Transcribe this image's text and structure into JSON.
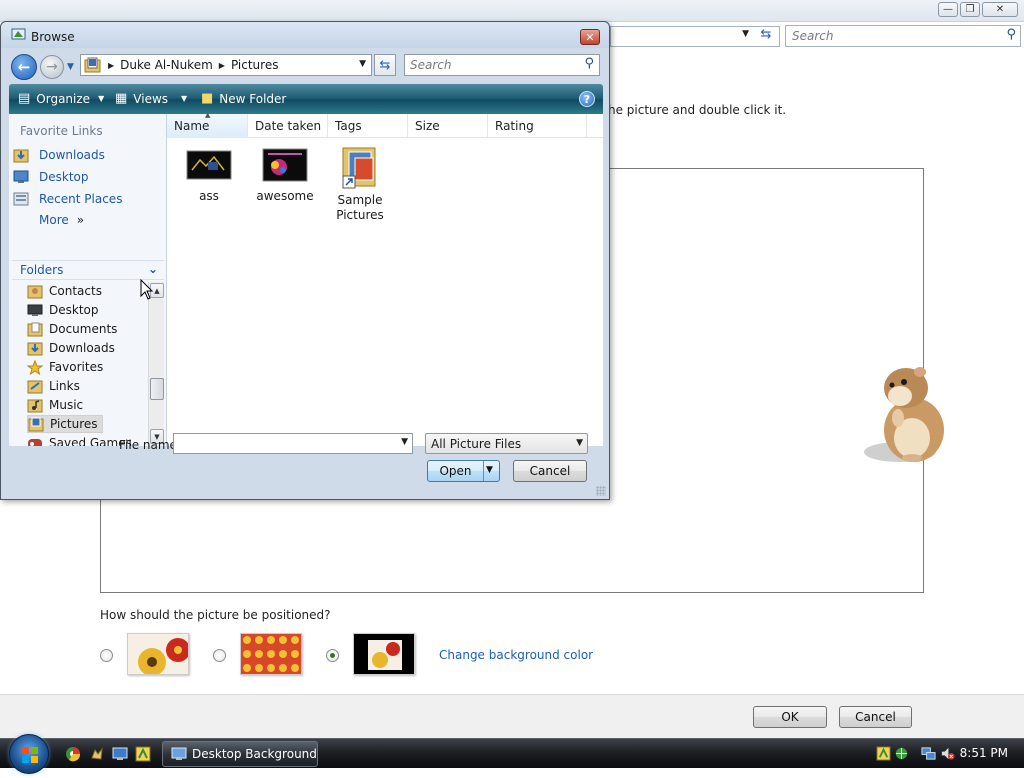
{
  "background_window": {
    "search_placeholder": "Search",
    "instruction_text": "he picture and double click it.",
    "position_question": "How should the picture be positioned?",
    "change_bg_color_link": "Change background color",
    "position_options": [
      {
        "name": "fit-to-screen",
        "selected": false
      },
      {
        "name": "tile",
        "selected": false
      },
      {
        "name": "center",
        "selected": true
      }
    ],
    "ok_label": "OK",
    "cancel_label": "Cancel",
    "window_controls": {
      "minimize": "—",
      "maximize": "❐",
      "close": "✕"
    }
  },
  "dialog": {
    "title": "Browse",
    "close_glyph": "✕",
    "breadcrumb": [
      "Duke Al-Nukem",
      "Pictures"
    ],
    "search_placeholder": "Search",
    "toolbar": {
      "organize": "Organize",
      "views": "Views",
      "new_folder": "New Folder",
      "help": "?"
    },
    "favorite_links": {
      "header": "Favorite Links",
      "items": [
        {
          "label": "Downloads",
          "icon": "downloads-icon"
        },
        {
          "label": "Desktop",
          "icon": "desktop-icon"
        },
        {
          "label": "Recent Places",
          "icon": "recent-places-icon"
        },
        {
          "label": "More",
          "icon": "more-chevron-icon",
          "glyph": "»"
        }
      ]
    },
    "folders_header": "Folders",
    "folder_tree": [
      {
        "label": "Contacts",
        "icon": "contacts-folder-icon",
        "selected": false
      },
      {
        "label": "Desktop",
        "icon": "desktop-icon",
        "selected": false
      },
      {
        "label": "Documents",
        "icon": "documents-folder-icon",
        "selected": false
      },
      {
        "label": "Downloads",
        "icon": "downloads-folder-icon",
        "selected": false
      },
      {
        "label": "Favorites",
        "icon": "favorites-star-icon",
        "selected": false
      },
      {
        "label": "Links",
        "icon": "links-folder-icon",
        "selected": false
      },
      {
        "label": "Music",
        "icon": "music-folder-icon",
        "selected": false
      },
      {
        "label": "Pictures",
        "icon": "pictures-folder-icon",
        "selected": true
      },
      {
        "label": "Saved Games",
        "icon": "saved-games-icon",
        "selected": false
      }
    ],
    "columns": [
      "Name",
      "Date taken",
      "Tags",
      "Size",
      "Rating"
    ],
    "sorted_column": "Name",
    "files": [
      {
        "label": "ass",
        "type": "image"
      },
      {
        "label": "awesome",
        "type": "image"
      },
      {
        "label": "Sample Pictures",
        "type": "folder-shortcut"
      }
    ],
    "filename_label": "File name:",
    "filename_value": "",
    "filetype_value": "All Picture Files",
    "open_label": "Open",
    "cancel_label": "Cancel"
  },
  "taskbar": {
    "task_button_label": "Desktop Background",
    "clock": "8:51 PM"
  },
  "colors": {
    "toolbar": "#1e5c73",
    "link": "#1f57a4",
    "dialog_frame": "#cfdbe8",
    "taskbar": "#1b1e22"
  }
}
